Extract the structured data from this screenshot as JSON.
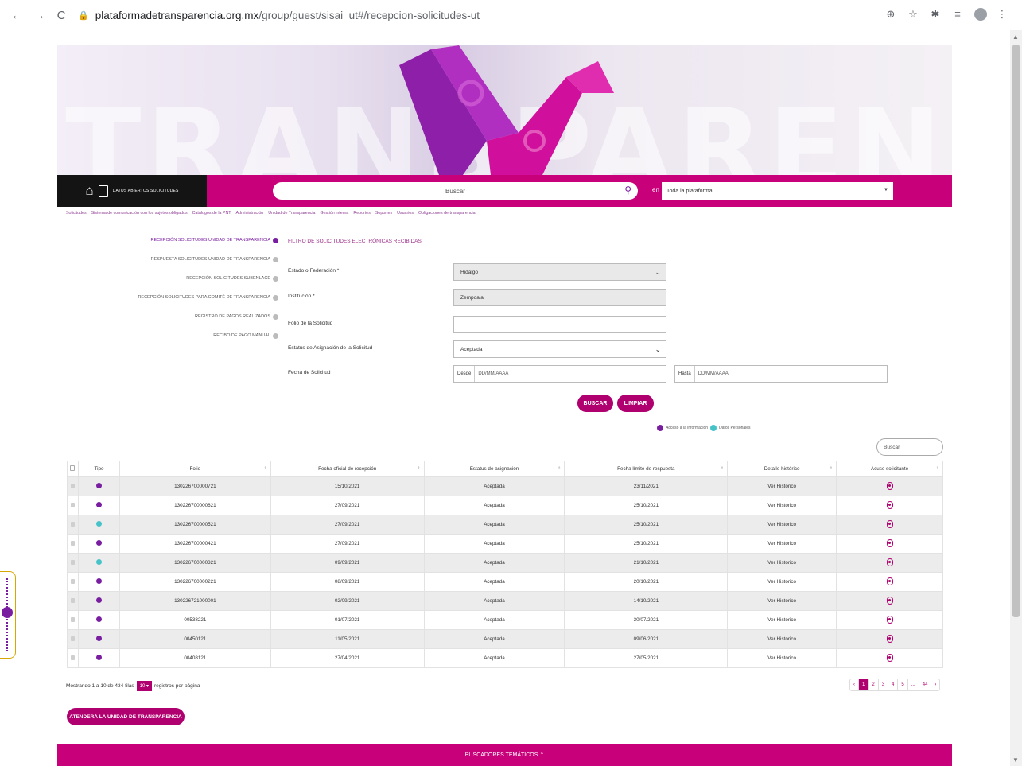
{
  "browser": {
    "url_host": "plataformadetransparencia.org.mx",
    "url_path": "/group/guest/sisai_ut#/recepcion-solicitudes-ut"
  },
  "banner": {
    "watermark": "TRANSPARENCIA"
  },
  "topbar": {
    "section_label": "DATOS ABIERTOS SOLICITUDES",
    "search_placeholder": "Buscar",
    "en_label": "en",
    "scope_value": "Toda la plataforma"
  },
  "menu": [
    "Solicitudes",
    "Sistema de comunicación con los sujetos obligados",
    "Catálogos de la PNT",
    "Administración",
    "Unidad de Transparencia",
    "Gestión interna",
    "Reportes",
    "Soportes",
    "Usuarios",
    "Obligaciones de transparencia"
  ],
  "leftnav": [
    "RECEPCIÓN SOLICITUDES UNIDAD DE TRANSPARENCIA",
    "RESPUESTA SOLICITUDES UNIDAD DE TRANSPARENCIA",
    "RECEPCIÓN SOLICITUDES SUBENLACE",
    "RECEPCIÓN SOLICITUDES PARA COMITÉ DE TRANSPARENCIA",
    "REGISTRO DE PAGOS REALIZADOS",
    "RECIBO DE PAGO MANUAL"
  ],
  "form": {
    "title": "FILTRO DE SOLICITUDES ELECTRÓNICAS RECIBIDAS",
    "estado_label": "Estado o Federación *",
    "estado_value": "Hidalgo",
    "institucion_label": "Institución *",
    "institucion_value": "Zempoala",
    "folio_label": "Folio de la Solicitud",
    "estatus_label": "Estatus de Asignación de la Solicitud",
    "estatus_value": "Aceptada",
    "fecha_label": "Fecha de Solicitud",
    "desde_label": "Desde",
    "hasta_label": "Hasta",
    "date_placeholder": "DD/MM/AAAA",
    "buscar_button": "BUSCAR",
    "limpiar_button": "LIMPIAR"
  },
  "legend": {
    "acceso": "Acceso a la información",
    "datos": "Datos Personales",
    "acceso_color": "#7a1ea1",
    "datos_color": "#45c3c9"
  },
  "table_search_placeholder": "Buscar",
  "table": {
    "headers": [
      "Tipo",
      "Folio",
      "Fecha oficial de recepción",
      "Estatus de asignación",
      "Fecha límite de respuesta",
      "Detalle histórico",
      "Acuse solicitante"
    ],
    "rows": [
      {
        "tipo": "acceso",
        "folio": "130226700000721",
        "fecha": "15/10/2021",
        "estatus": "Aceptada",
        "limite": "23/11/2021",
        "detalle": "Ver Histórico"
      },
      {
        "tipo": "acceso",
        "folio": "130226700000621",
        "fecha": "27/09/2021",
        "estatus": "Aceptada",
        "limite": "25/10/2021",
        "detalle": "Ver Histórico"
      },
      {
        "tipo": "datos",
        "folio": "130226700000521",
        "fecha": "27/09/2021",
        "estatus": "Aceptada",
        "limite": "25/10/2021",
        "detalle": "Ver Histórico"
      },
      {
        "tipo": "acceso",
        "folio": "130226700000421",
        "fecha": "27/09/2021",
        "estatus": "Aceptada",
        "limite": "25/10/2021",
        "detalle": "Ver Histórico"
      },
      {
        "tipo": "datos",
        "folio": "130226700000321",
        "fecha": "09/09/2021",
        "estatus": "Aceptada",
        "limite": "21/10/2021",
        "detalle": "Ver Histórico"
      },
      {
        "tipo": "acceso",
        "folio": "130226700000221",
        "fecha": "08/09/2021",
        "estatus": "Aceptada",
        "limite": "20/10/2021",
        "detalle": "Ver Histórico"
      },
      {
        "tipo": "acceso",
        "folio": "130226721000001",
        "fecha": "02/09/2021",
        "estatus": "Aceptada",
        "limite": "14/10/2021",
        "detalle": "Ver Histórico"
      },
      {
        "tipo": "acceso",
        "folio": "00538221",
        "fecha": "01/07/2021",
        "estatus": "Aceptada",
        "limite": "30/07/2021",
        "detalle": "Ver Histórico"
      },
      {
        "tipo": "acceso",
        "folio": "00450121",
        "fecha": "11/05/2021",
        "estatus": "Aceptada",
        "limite": "09/06/2021",
        "detalle": "Ver Histórico"
      },
      {
        "tipo": "acceso",
        "folio": "00408121",
        "fecha": "27/04/2021",
        "estatus": "Aceptada",
        "limite": "27/05/2021",
        "detalle": "Ver Histórico"
      }
    ]
  },
  "pagination": {
    "showing_text": "Mostrando 1 a 10 de 434 filas",
    "per_page": "10",
    "per_page_suffix": "registros por página",
    "prev": "‹",
    "pages": [
      "1",
      "2",
      "3",
      "4",
      "5",
      "...",
      "44"
    ],
    "next": "›"
  },
  "atendera_button": "ATENDERÁ LA UNIDAD DE TRANSPARENCIA",
  "footer_label": "BUSCADORES TEMÁTICOS ⌃"
}
